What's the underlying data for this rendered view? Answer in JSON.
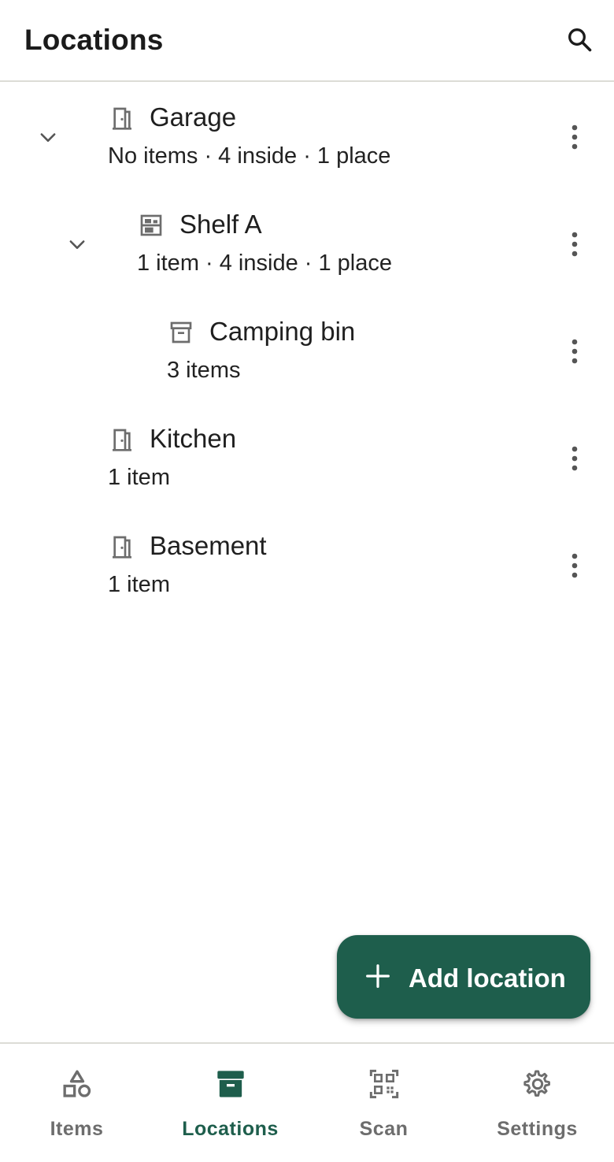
{
  "header": {
    "title": "Locations",
    "search_icon": "search-icon"
  },
  "tree": [
    {
      "name": "Garage",
      "meta": "No items · 4 inside · 1 place",
      "icon": "door-building-icon",
      "expanded": true,
      "depth": 0
    },
    {
      "name": "Shelf A",
      "meta": "1 item · 4 inside · 1 place",
      "icon": "shelf-icon",
      "expanded": true,
      "depth": 1
    },
    {
      "name": "Camping bin",
      "meta": "3 items",
      "icon": "archive-box-icon",
      "depth": 2
    },
    {
      "name": "Kitchen",
      "meta": "1 item",
      "icon": "door-building-icon",
      "depth": 0
    },
    {
      "name": "Basement",
      "meta": "1 item",
      "icon": "door-building-icon",
      "depth": 0
    }
  ],
  "fab": {
    "label": "Add location",
    "icon": "plus-icon"
  },
  "bottom_nav": [
    {
      "label": "Items",
      "icon": "shapes-icon",
      "active": false
    },
    {
      "label": "Locations",
      "icon": "archive-box-icon",
      "active": true
    },
    {
      "label": "Scan",
      "icon": "qr-code-icon",
      "active": false
    },
    {
      "label": "Settings",
      "icon": "gear-icon",
      "active": false
    }
  ],
  "colors": {
    "accent": "#1e5e4c",
    "icon_gray": "#6d6d6d",
    "divider": "#dcdcd6"
  }
}
